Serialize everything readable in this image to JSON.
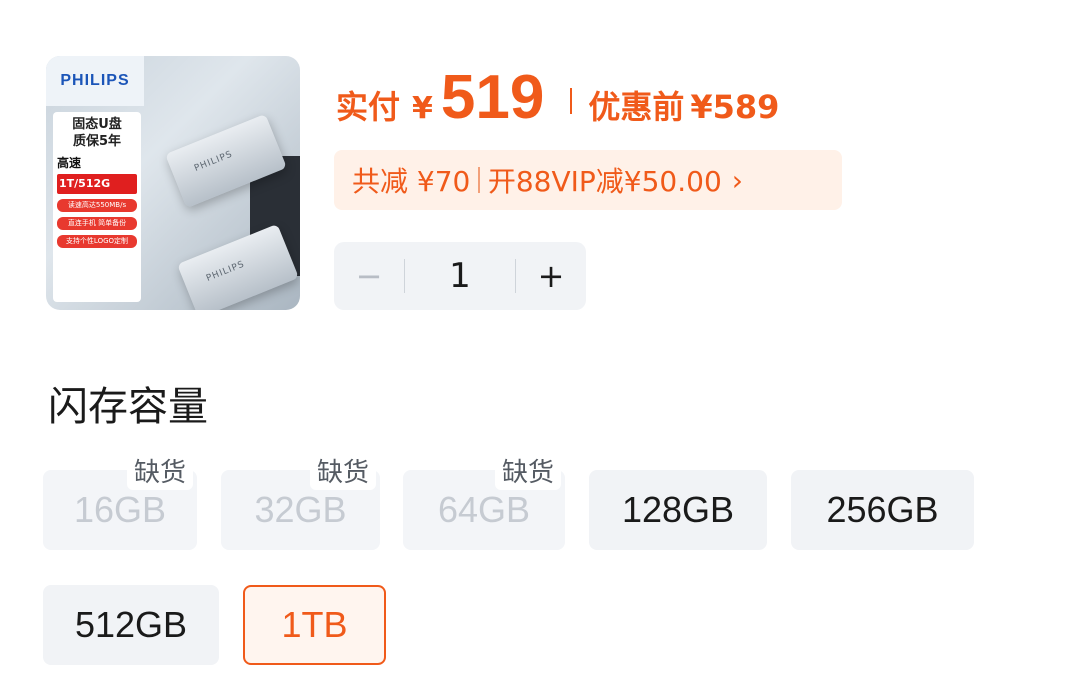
{
  "product": {
    "image": {
      "brand": "PHILIPS",
      "headline_1": "固态U盘",
      "headline_2": "质保5年",
      "speed_label": "高速",
      "capacity_label": "1T/512G",
      "chips": [
        "读速高达550MB/s",
        "直连手机 简单备份",
        "支持个性LOGO定制"
      ],
      "drive_text": "PHILIPS"
    }
  },
  "price": {
    "paid_label": "实付",
    "currency": "¥",
    "paid_amount": "519",
    "original_label": "优惠前",
    "original_amount": "¥589"
  },
  "discount": {
    "total_text": "共减 ¥70",
    "vip_text": "开88VIP减¥50.00",
    "chevron": "›"
  },
  "quantity": {
    "minus": "−",
    "value": "1",
    "plus": "+"
  },
  "capacity": {
    "title": "闪存容量",
    "out_of_stock_label": "缺货",
    "options": [
      {
        "label": "16GB",
        "state": "disabled"
      },
      {
        "label": "32GB",
        "state": "disabled"
      },
      {
        "label": "64GB",
        "state": "disabled"
      },
      {
        "label": "128GB",
        "state": "available"
      },
      {
        "label": "256GB",
        "state": "available"
      },
      {
        "label": "512GB",
        "state": "available"
      },
      {
        "label": "1TB",
        "state": "selected"
      }
    ]
  },
  "colors": {
    "accent": "#f05a1a",
    "pill_bg": "#fff1e8",
    "option_bg": "#f1f3f6"
  }
}
